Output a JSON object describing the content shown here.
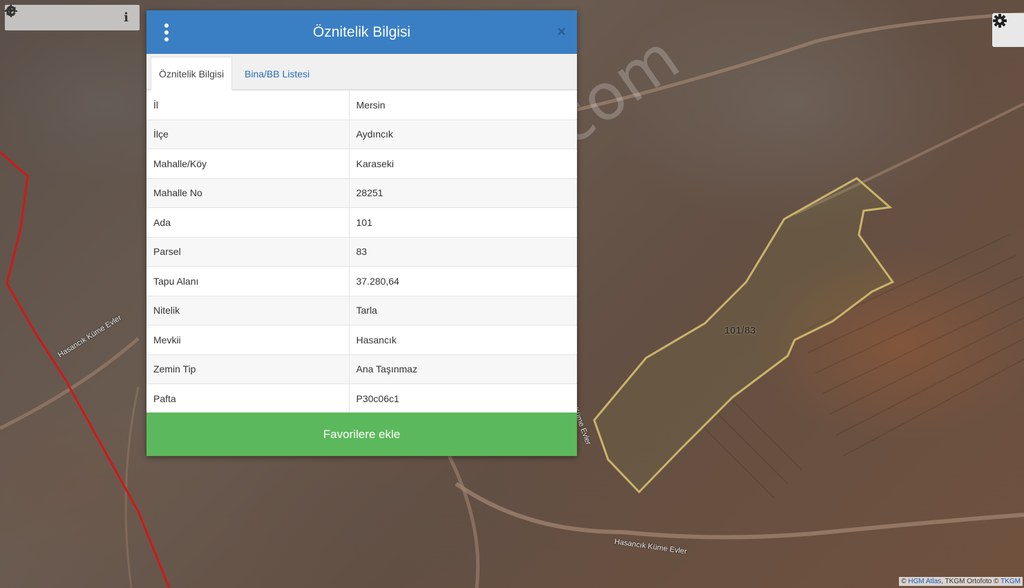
{
  "toolbar": {
    "zoom_in": "+",
    "zoom_out": "−",
    "info": "i",
    "icons": [
      "plus-icon",
      "minus-icon",
      "refresh-icon",
      "locate-icon",
      "info-icon"
    ]
  },
  "map": {
    "watermark": "emlakjet.com",
    "parcel_label": "101/83",
    "road_labels": [
      "Hasancık Küme Evler",
      "Hasancık Küme Evler",
      "Küme Evler"
    ],
    "attribution": {
      "prefix": "© ",
      "link1": "HGM Atlas",
      "middle": ", TKGM Ortofoto © ",
      "link2": "TKGM"
    },
    "colors": {
      "parcel_outline": "#c9b56a",
      "boundary_line": "#d01818",
      "road": "#a08470"
    }
  },
  "dialog": {
    "title": "Öznitelik Bilgisi",
    "close": "×",
    "tabs": [
      {
        "label": "Öznitelik Bilgisi",
        "active": true
      },
      {
        "label": "Bina/BB Listesi",
        "active": false
      }
    ],
    "rows": [
      {
        "key": "İl",
        "value": "Mersin"
      },
      {
        "key": "İlçe",
        "value": "Aydıncık"
      },
      {
        "key": "Mahalle/Köy",
        "value": "Karaseki"
      },
      {
        "key": "Mahalle No",
        "value": "28251"
      },
      {
        "key": "Ada",
        "value": "101"
      },
      {
        "key": "Parsel",
        "value": "83"
      },
      {
        "key": "Tapu Alanı",
        "value": "37.280,64"
      },
      {
        "key": "Nitelik",
        "value": "Tarla"
      },
      {
        "key": "Mevkii",
        "value": "Hasancık"
      },
      {
        "key": "Zemin Tip",
        "value": "Ana Taşınmaz"
      },
      {
        "key": "Pafta",
        "value": "P30c06c1"
      }
    ],
    "favorite_button": "Favorilere ekle",
    "colors": {
      "header": "#3a7fc4",
      "button": "#5cb85c"
    }
  }
}
